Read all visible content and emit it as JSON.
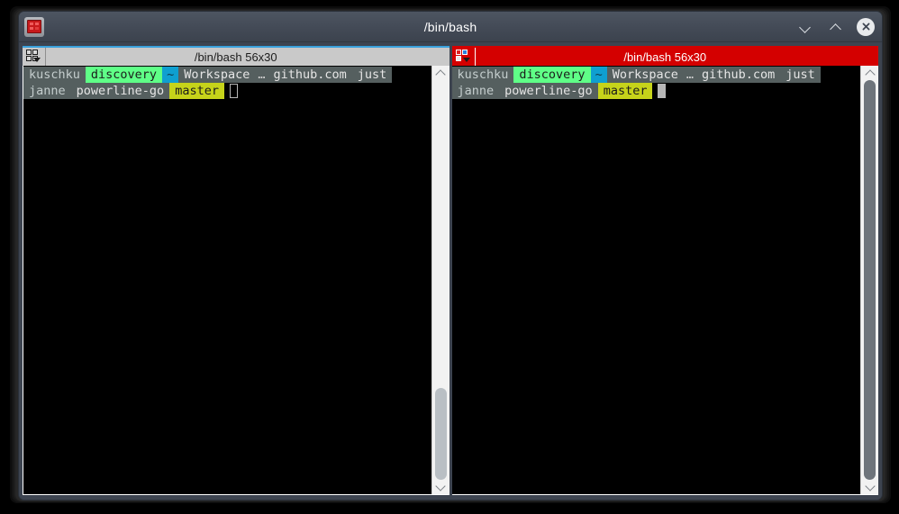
{
  "window": {
    "title": "/bin/bash",
    "app_icon": "terminal-icon",
    "controls": {
      "minimize": "chevron-down-icon",
      "maximize": "chevron-up-icon",
      "close": "close-icon"
    }
  },
  "panes": [
    {
      "id": "left",
      "state": "inactive",
      "header_title": "/bin/bash 56x30",
      "split_icon": "split-layout-icon",
      "prompt": {
        "user": "kuschku",
        "host": "discovery",
        "home": "~",
        "path_first": "Workspace",
        "path_ellipsis": "…",
        "path_second": "github.com",
        "path_third": "just",
        "git_user": "janne",
        "repo": "powerline-go",
        "branch": "master"
      },
      "cursor": "hollow",
      "scrollbar": {
        "up_arrow": "scroll-up-icon",
        "down_arrow": "scroll-down-icon",
        "thumb_top_pct": 77,
        "thumb_height_pct": 23,
        "thumb_style": "partial"
      }
    },
    {
      "id": "right",
      "state": "active",
      "header_title": "/bin/bash 56x30",
      "split_icon": "split-layout-icon",
      "prompt": {
        "user": "kuschku",
        "host": "discovery",
        "home": "~",
        "path_first": "Workspace",
        "path_ellipsis": "…",
        "path_second": "github.com",
        "path_third": "just",
        "git_user": "janne",
        "repo": "powerline-go",
        "branch": "master"
      },
      "cursor": "solid",
      "scrollbar": {
        "up_arrow": "scroll-up-icon",
        "down_arrow": "scroll-down-icon",
        "thumb_top_pct": 0,
        "thumb_height_pct": 100,
        "thumb_style": "over"
      }
    }
  ],
  "colors": {
    "titlebar": "#434a56",
    "active_pane": "#d40000",
    "inactive_pane": "#c9c9c9",
    "accent_blue": "#3aa2dd",
    "host_green": "#5fff87",
    "tilde_cyan": "#0f9fd0",
    "branch_yellow": "#c6d31a",
    "terminal_bg": "#000000"
  }
}
